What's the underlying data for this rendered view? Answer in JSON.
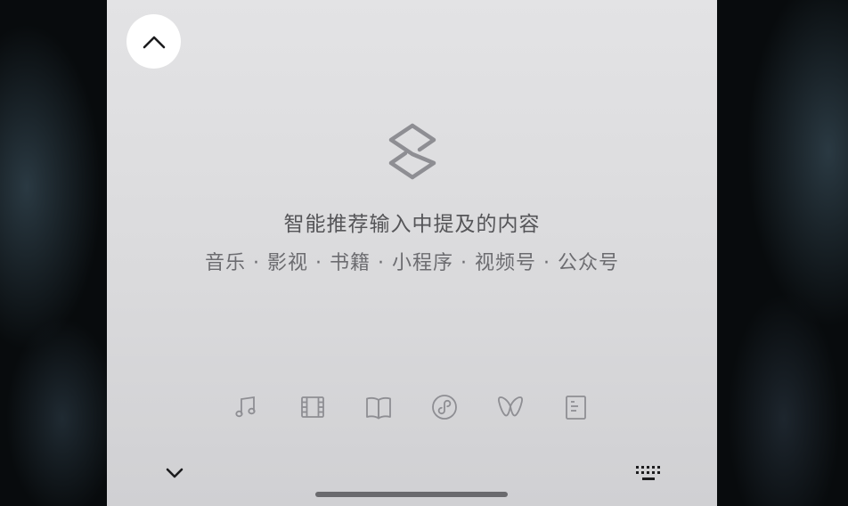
{
  "panel": {
    "headline": "智能推荐输入中提及的内容",
    "subline": "音乐 · 影视 · 书籍 · 小程序 · 视频号 · 公众号"
  },
  "icons": {
    "collapse": "chevron-up-icon",
    "logo": "smart-recommend-logo-icon",
    "categories": [
      "music-icon",
      "film-icon",
      "book-icon",
      "mini-program-icon",
      "channels-icon",
      "article-icon"
    ],
    "dismiss": "chevron-down-icon",
    "keyboard": "keyboard-icon"
  },
  "colors": {
    "panel_bg": "#dcdcde",
    "icon_gray": "#8e8e93",
    "text_primary": "#555558",
    "text_secondary": "#6c6c70",
    "home_indicator": "#6a6a6e"
  }
}
